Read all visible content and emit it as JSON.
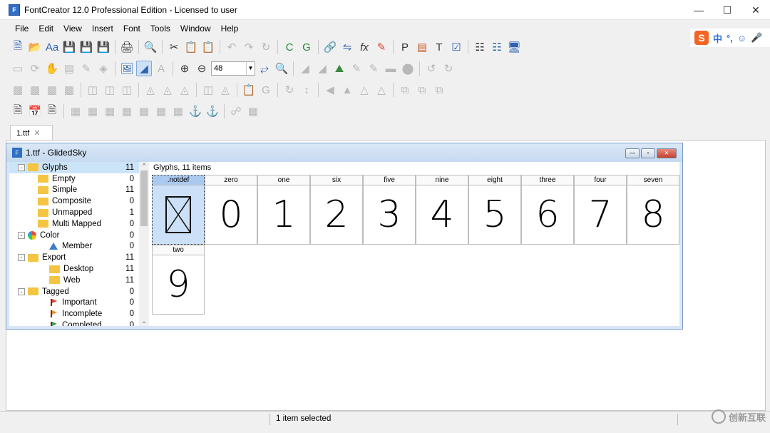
{
  "window": {
    "title": "FontCreator 12.0 Professional Edition - Licensed to user",
    "app_icon": "F"
  },
  "menu": [
    "File",
    "Edit",
    "View",
    "Insert",
    "Font",
    "Tools",
    "Window",
    "Help"
  ],
  "toolbar": {
    "zoom_value": "48"
  },
  "ime": {
    "labels": [
      "中",
      "°,",
      "☺",
      "🎤"
    ]
  },
  "tab": {
    "label": "1.ttf"
  },
  "mdi": {
    "title": "1.ttf - GlidedSky"
  },
  "tree": [
    {
      "label": "Glyphs",
      "count": "11",
      "level": 0,
      "type": "folder",
      "selected": true,
      "expander": "-"
    },
    {
      "label": "Empty",
      "count": "0",
      "level": 1,
      "type": "folder"
    },
    {
      "label": "Simple",
      "count": "11",
      "level": 1,
      "type": "folder"
    },
    {
      "label": "Composite",
      "count": "0",
      "level": 1,
      "type": "folder"
    },
    {
      "label": "Unmapped",
      "count": "1",
      "level": 1,
      "type": "folder"
    },
    {
      "label": "Multi Mapped",
      "count": "0",
      "level": 1,
      "type": "folder"
    },
    {
      "label": "Color",
      "count": "0",
      "level": 0,
      "type": "color",
      "expander": "-"
    },
    {
      "label": "Member",
      "count": "0",
      "level": 2,
      "type": "triangle"
    },
    {
      "label": "Export",
      "count": "11",
      "level": 0,
      "type": "folder",
      "expander": "-"
    },
    {
      "label": "Desktop",
      "count": "11",
      "level": 2,
      "type": "folder"
    },
    {
      "label": "Web",
      "count": "11",
      "level": 2,
      "type": "folder"
    },
    {
      "label": "Tagged",
      "count": "0",
      "level": 0,
      "type": "folder",
      "expander": "-"
    },
    {
      "label": "Important",
      "count": "0",
      "level": 2,
      "type": "flag-red"
    },
    {
      "label": "Incomplete",
      "count": "0",
      "level": 2,
      "type": "flag-orange"
    },
    {
      "label": "Completed",
      "count": "0",
      "level": 2,
      "type": "flag-green"
    }
  ],
  "grid": {
    "header": "Glyphs, 11 items",
    "glyphs": [
      {
        "name": ".notdef",
        "char": "",
        "selected": true
      },
      {
        "name": "zero",
        "char": "0"
      },
      {
        "name": "one",
        "char": "1"
      },
      {
        "name": "six",
        "char": "2"
      },
      {
        "name": "five",
        "char": "3"
      },
      {
        "name": "nine",
        "char": "4"
      },
      {
        "name": "eight",
        "char": "5"
      },
      {
        "name": "three",
        "char": "6"
      },
      {
        "name": "four",
        "char": "7"
      },
      {
        "name": "seven",
        "char": "8"
      },
      {
        "name": "two",
        "char": "9"
      }
    ]
  },
  "status": {
    "text": "1 item selected"
  },
  "watermark": {
    "text": "创新互联"
  }
}
